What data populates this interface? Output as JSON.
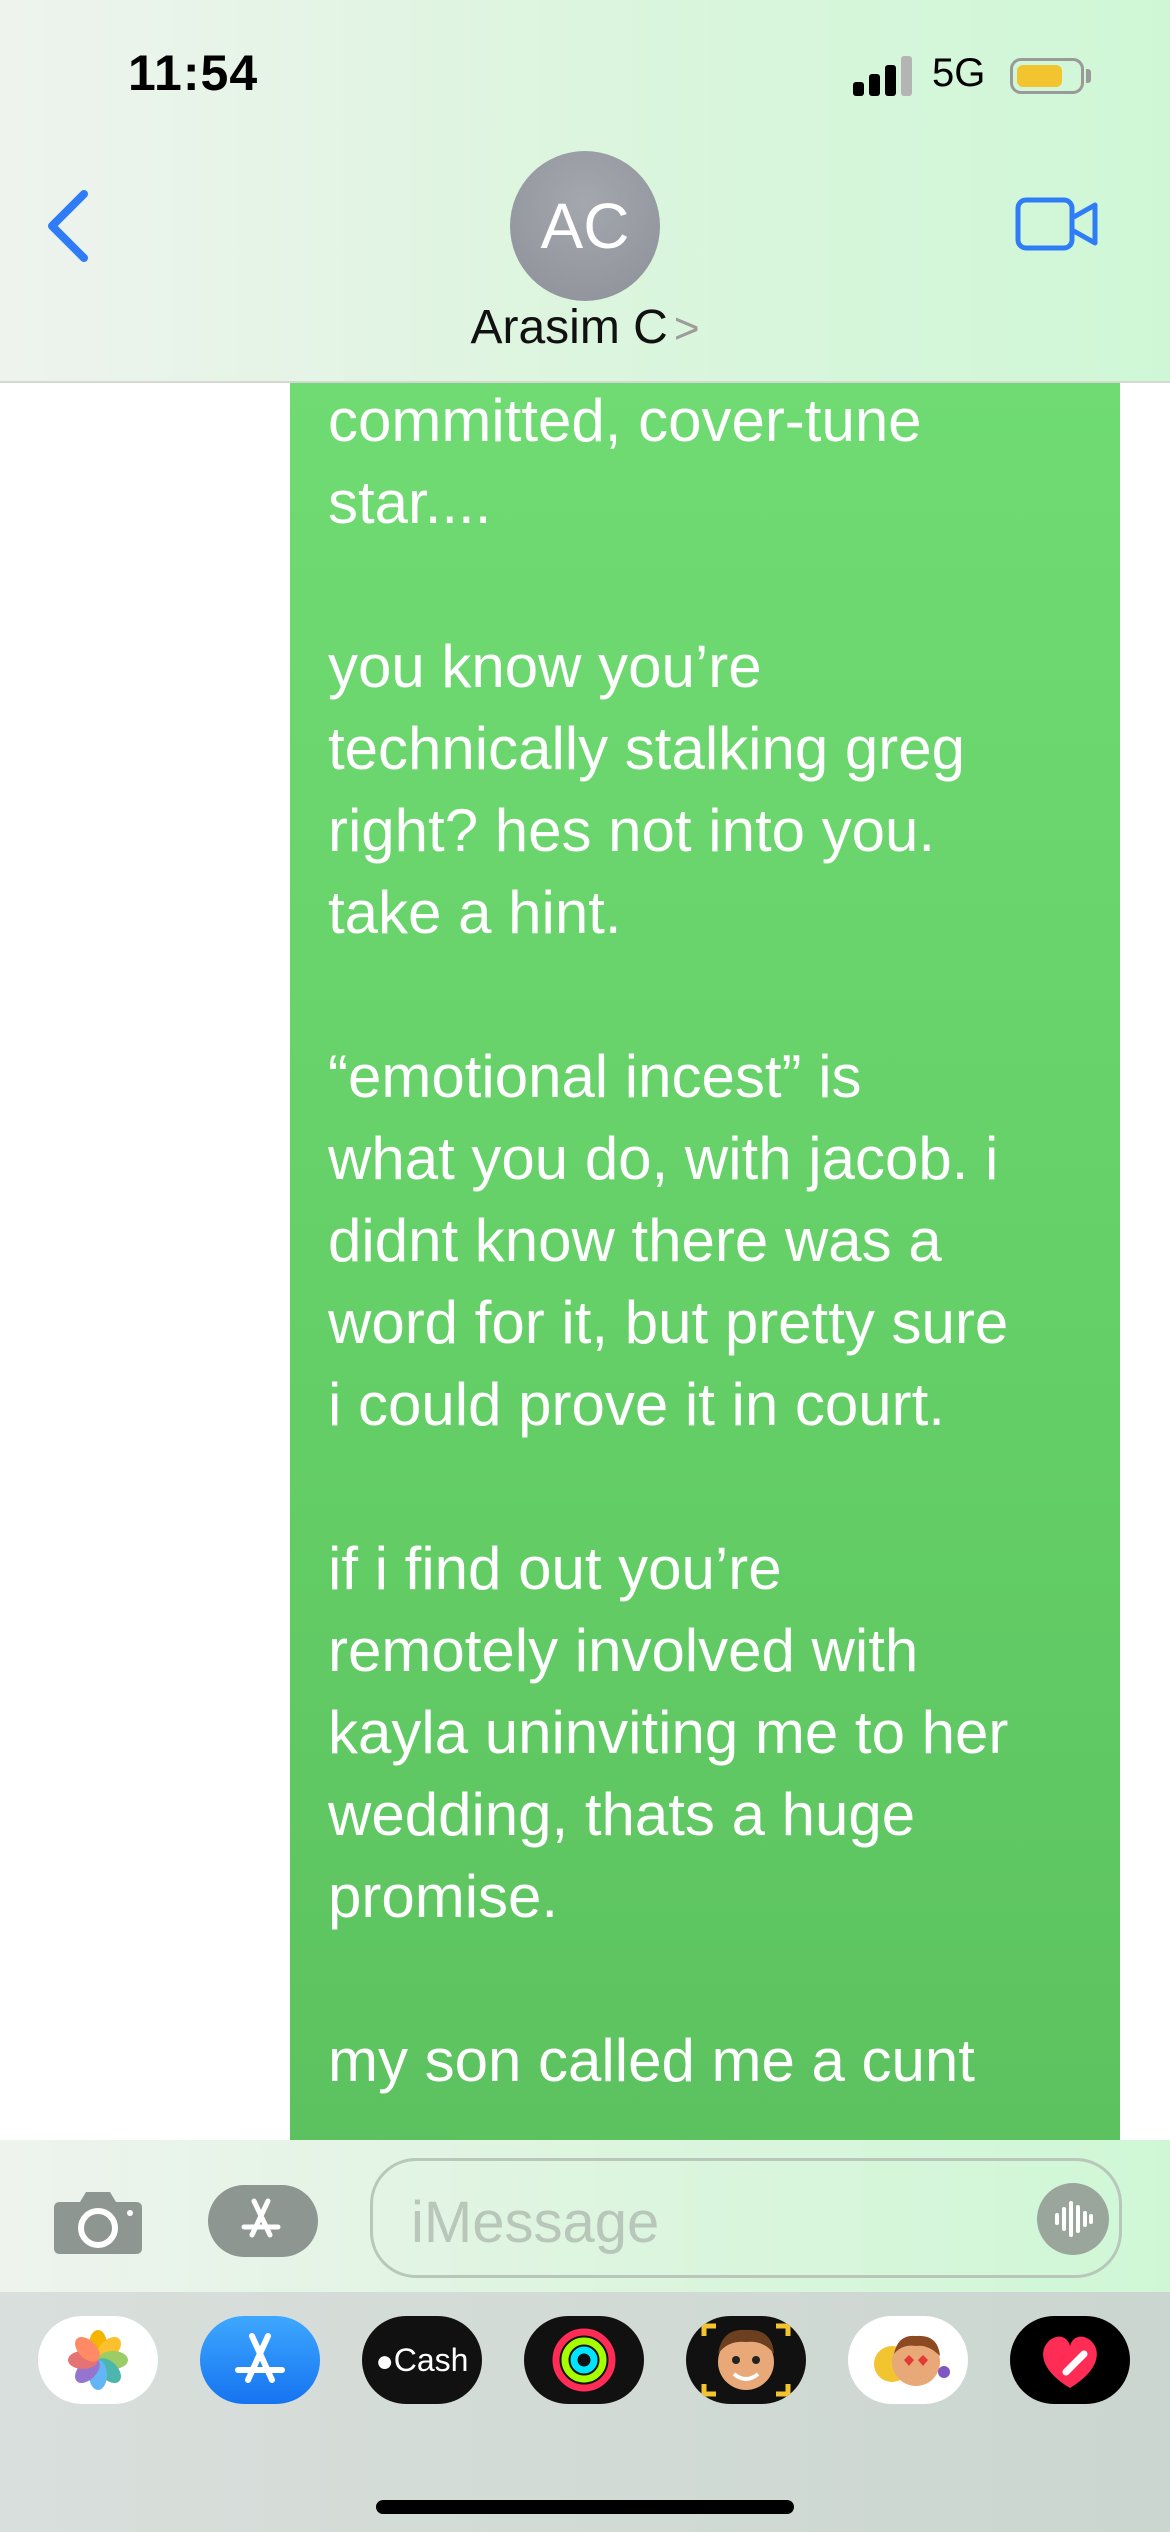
{
  "status_bar": {
    "time": "11:54",
    "network": "5G",
    "signal_bars": 3,
    "battery_level": 0.75,
    "battery_color": "#f2c530"
  },
  "header": {
    "back_icon": "chevron-left-icon",
    "avatar_initials": "AC",
    "contact_name": "Arasim C",
    "contact_chevron": ">",
    "video_icon": "video-camera-icon",
    "accent_color": "#2f7cf6"
  },
  "conversation": {
    "bubble_color": "#65d068",
    "paragraphs": [
      "committed, cover-tune\nstar....",
      "you know you’re\ntechnically stalking greg\nright? hes not into you.\ntake a hint.",
      "“emotional incest” is\nwhat you do, with jacob. i\ndidnt know there was a\nword for it, but pretty sure\ni could prove it in court.",
      "if i find out you’re\nremotely involved with\nkayla uninviting me to her\nwedding, thats a huge\npromise.",
      "my son called me a cunt"
    ]
  },
  "input_bar": {
    "camera_icon": "camera-icon",
    "apps_icon": "app-store-icon",
    "placeholder": "iMessage",
    "audio_icon": "audio-waveform-icon"
  },
  "app_drawer": {
    "apps": [
      {
        "name": "Photos",
        "icon": "photos-icon"
      },
      {
        "name": "App Store",
        "icon": "app-store-icon"
      },
      {
        "name": "Cash",
        "icon": "apple-cash-icon",
        "label": "Cash"
      },
      {
        "name": "Activity",
        "icon": "activity-rings-icon"
      },
      {
        "name": "Memoji",
        "icon": "memoji-icon"
      },
      {
        "name": "Memoji Stickers",
        "icon": "memoji-stickers-icon"
      },
      {
        "name": "Digital Touch",
        "icon": "digital-touch-icon"
      }
    ]
  }
}
